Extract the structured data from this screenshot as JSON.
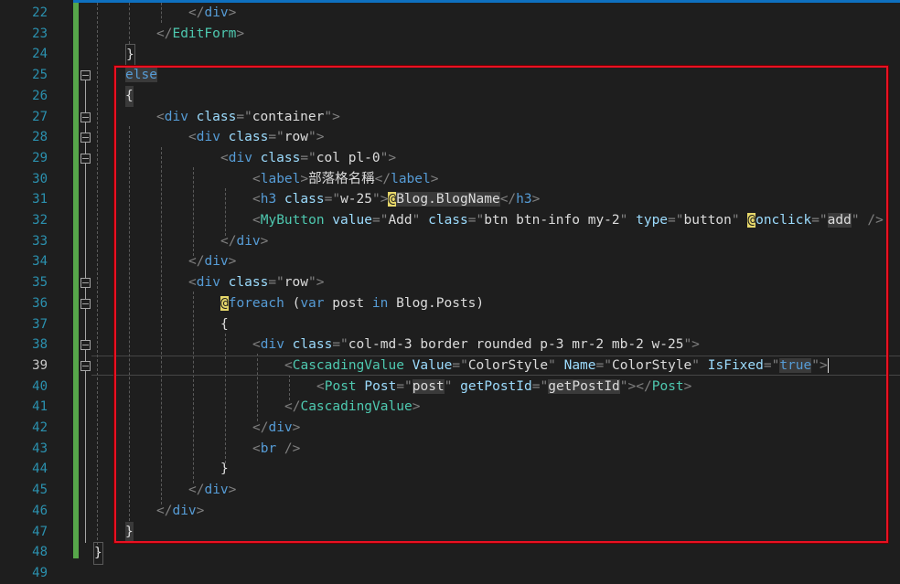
{
  "editor": {
    "line_numbers": [
      "22",
      "23",
      "24",
      "25",
      "26",
      "27",
      "28",
      "29",
      "30",
      "31",
      "32",
      "33",
      "34",
      "35",
      "36",
      "37",
      "38",
      "39",
      "40",
      "41",
      "42",
      "43",
      "44",
      "45",
      "46",
      "47",
      "48",
      "49"
    ],
    "lines": {
      "l22": {
        "a": "</",
        "b": "div",
        "c": ">"
      },
      "l23": {
        "a": "</",
        "b": "EditForm",
        "c": ">"
      },
      "l24": {
        "a": "}"
      },
      "l25": {
        "a": "else"
      },
      "l26": {
        "a": "{"
      },
      "l27": {
        "a": "<",
        "b": "div",
        "c": " class",
        "d": "=\"",
        "e": "container",
        "f": "\">"
      },
      "l28": {
        "a": "<",
        "b": "div",
        "c": " class",
        "d": "=\"",
        "e": "row",
        "f": "\">"
      },
      "l29": {
        "a": "<",
        "b": "div",
        "c": " class",
        "d": "=\"",
        "e": "col pl-0",
        "f": "\">"
      },
      "l30": {
        "a": "<",
        "b": "label",
        "c": ">",
        "d": "部落格名稱",
        "e": "</",
        "f": "label",
        "g": ">"
      },
      "l31": {
        "a": "<",
        "b": "h3",
        "c": " class",
        "d": "=\"",
        "e": "w-25",
        "f": "\">",
        "g": "@",
        "h": "Blog.BlogName",
        "i": "</",
        "j": "h3",
        "k": ">"
      },
      "l32": {
        "a": "<",
        "b": "MyButton",
        "c": " value",
        "d": "=\"",
        "e": "Add",
        "f": "\"",
        "g": " class",
        "h": "=\"",
        "i": "btn btn-info my-2",
        "j": "\"",
        "k": " type",
        "l": "=\"",
        "m": "button",
        "n": "\" ",
        "o": "@",
        "p": "onclick",
        "q": "=\"",
        "r": "add",
        "s": "\" />"
      },
      "l33": {
        "a": "</",
        "b": "div",
        "c": ">"
      },
      "l34": {
        "a": "</",
        "b": "div",
        "c": ">"
      },
      "l35": {
        "a": "<",
        "b": "div",
        "c": " class",
        "d": "=\"",
        "e": "row",
        "f": "\">"
      },
      "l36": {
        "a": "@",
        "b": "foreach",
        "c": " (",
        "d": "var",
        "e": " post ",
        "f": "in",
        "g": " Blog.Posts)"
      },
      "l37": {
        "a": "{"
      },
      "l38": {
        "a": "<",
        "b": "div",
        "c": " class",
        "d": "=\"",
        "e": "col-md-3 border rounded p-3 mr-2 mb-2 w-25",
        "f": "\">"
      },
      "l39": {
        "a": "<",
        "b": "CascadingValue",
        "c": " Value",
        "d": "=\"",
        "e": "ColorStyle",
        "f": "\"",
        "g": " Name",
        "h": "=\"",
        "i": "ColorStyle",
        "j": "\"",
        "k": " IsFixed",
        "l": "=\"",
        "m": "true",
        "n": "\">"
      },
      "l40": {
        "a": "<",
        "b": "Post",
        "c": " Post",
        "d": "=\"",
        "e": "post",
        "f": "\"",
        "g": " getPostId",
        "h": "=\"",
        "i": "getPostId",
        "j": "\">",
        "k": "</",
        "l": "Post",
        "m": ">"
      },
      "l41": {
        "a": "</",
        "b": "CascadingValue",
        "c": ">"
      },
      "l42": {
        "a": "</",
        "b": "div",
        "c": ">"
      },
      "l43": {
        "a": "<",
        "b": "br",
        "c": " />"
      },
      "l44": {
        "a": "}"
      },
      "l45": {
        "a": "</",
        "b": "div",
        "c": ">"
      },
      "l46": {
        "a": "</",
        "b": "div",
        "c": ">"
      },
      "l47": {
        "a": "}"
      },
      "l48": {
        "a": "}"
      },
      "l49": {}
    }
  },
  "colors": {
    "line_number": "#2b91af",
    "tag": "#569cd6",
    "component": "#4ec9b0",
    "attribute": "#9cdcfe",
    "string": "#d69d85",
    "highlight_box": "#e81123",
    "change_bar": "#57a64a"
  },
  "icons": [
    "fold-collapse-icon"
  ]
}
